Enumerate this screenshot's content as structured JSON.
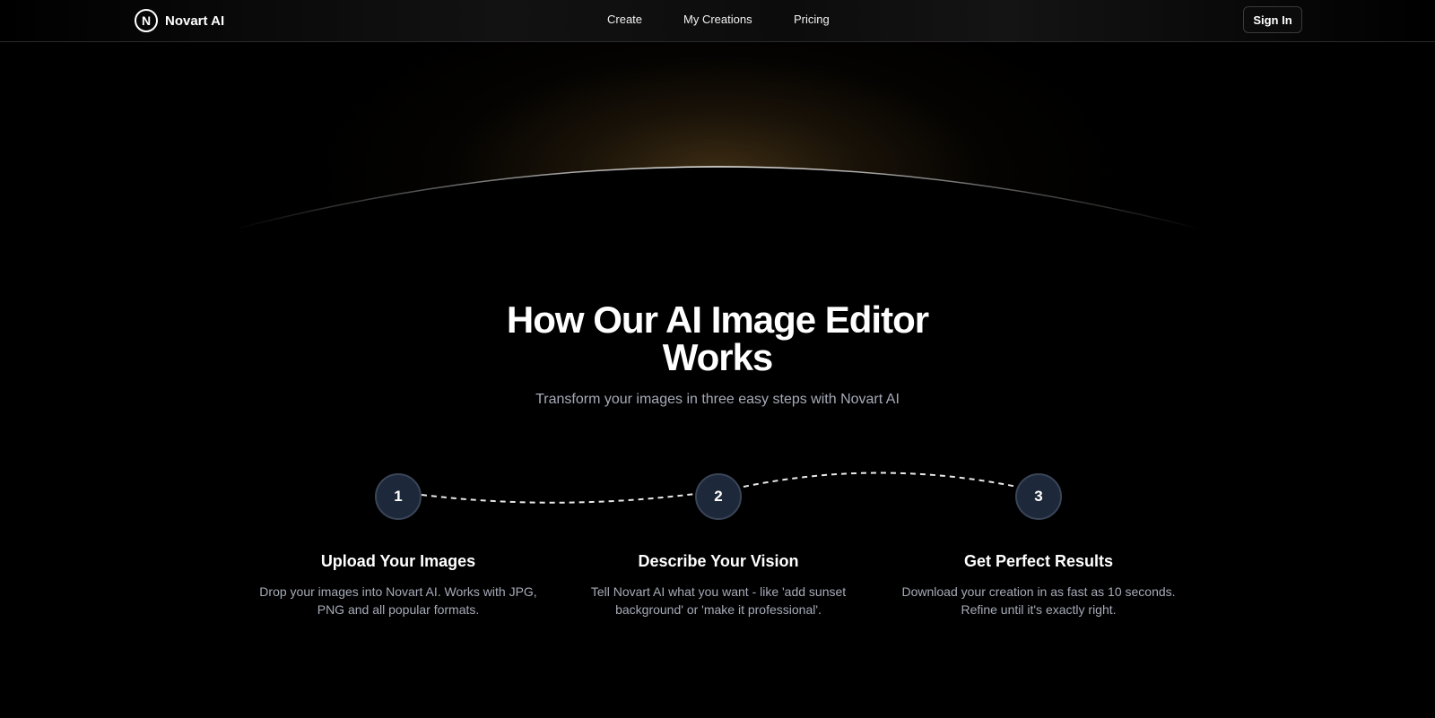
{
  "header": {
    "brand": {
      "logo_letter": "N",
      "name": "Novart AI"
    },
    "nav": [
      {
        "label": "Create"
      },
      {
        "label": "My Creations"
      },
      {
        "label": "Pricing"
      }
    ],
    "sign_in_label": "Sign In"
  },
  "hero": {
    "title": "How Our AI Image Editor Works",
    "subtitle": "Transform your images in three easy steps with Novart AI"
  },
  "steps": [
    {
      "number": "1",
      "title": "Upload Your Images",
      "description": "Drop your images into Novart AI. Works with JPG, PNG and all popular formats."
    },
    {
      "number": "2",
      "title": "Describe Your Vision",
      "description": "Tell Novart AI what you want - like 'add sunset background' or 'make it professional'."
    },
    {
      "number": "3",
      "title": "Get Perfect Results",
      "description": "Download your creation in as fast as 10 seconds. Refine until it's exactly right."
    }
  ],
  "colors": {
    "background": "#000000",
    "step_circle": "#1d283a",
    "muted_text": "#a6abb8",
    "glow": "#6e5023"
  }
}
